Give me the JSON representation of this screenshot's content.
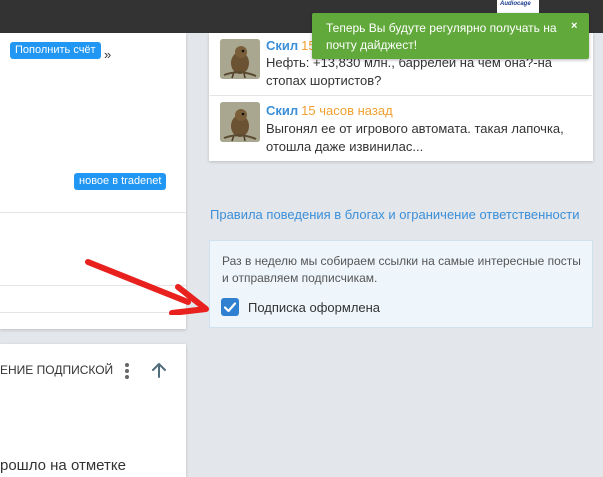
{
  "topbar": {
    "ad_text": "Audiocage"
  },
  "left_card_1": {
    "topup_button": "Пополнить счёт",
    "fragment_text": "»",
    "tradenet_badge": "новое в tradenet"
  },
  "left_card_2": {
    "title": "ЕНИЕ ПОДПИСКОЙ",
    "text": "рошло на отметке"
  },
  "comments": [
    {
      "author": "Скил",
      "time": "15",
      "text": "Нефть: +13,830 млн., баррелей на чем она?-на стопах шортистов?"
    },
    {
      "author": "Скил",
      "time": "15 часов назад",
      "text": "Выгонял ее от игрового автомата. такая лапочка, отошла даже извинилас..."
    }
  ],
  "rules_link": "Правила поведения в блогах и ограничение ответственности",
  "subscribe": {
    "description": "Раз в неделю мы собираем ссылки на самые интересные посты и отправляем подписчикам.",
    "checkbox_label": "Подписка оформлена",
    "checked": true
  },
  "toast": {
    "text": "Теперь Вы будуте регулярно получать на почту дайджест!",
    "close": "×"
  },
  "colors": {
    "toast_bg": "#62a93c",
    "link": "#3b8fd9",
    "time": "#f0a030",
    "badge": "#2196f3",
    "arrow": "#e8201e"
  },
  "icons": [
    "more-vertical-icon",
    "arrow-up-icon",
    "checkmark-icon",
    "close-icon"
  ]
}
